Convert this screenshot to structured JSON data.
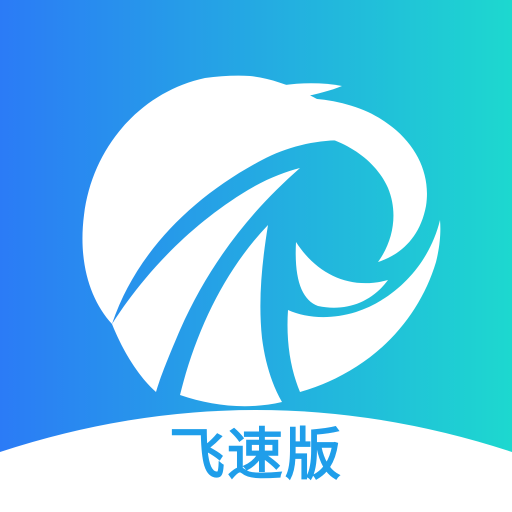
{
  "app_icon": {
    "label": "飞速版",
    "logo_icon": "swirl-globe-icon",
    "colors": {
      "gradient_start": "#2b7bf6",
      "gradient_end": "#1dd8cf",
      "logo": "#ffffff",
      "label_text": "#1f9eea"
    }
  }
}
